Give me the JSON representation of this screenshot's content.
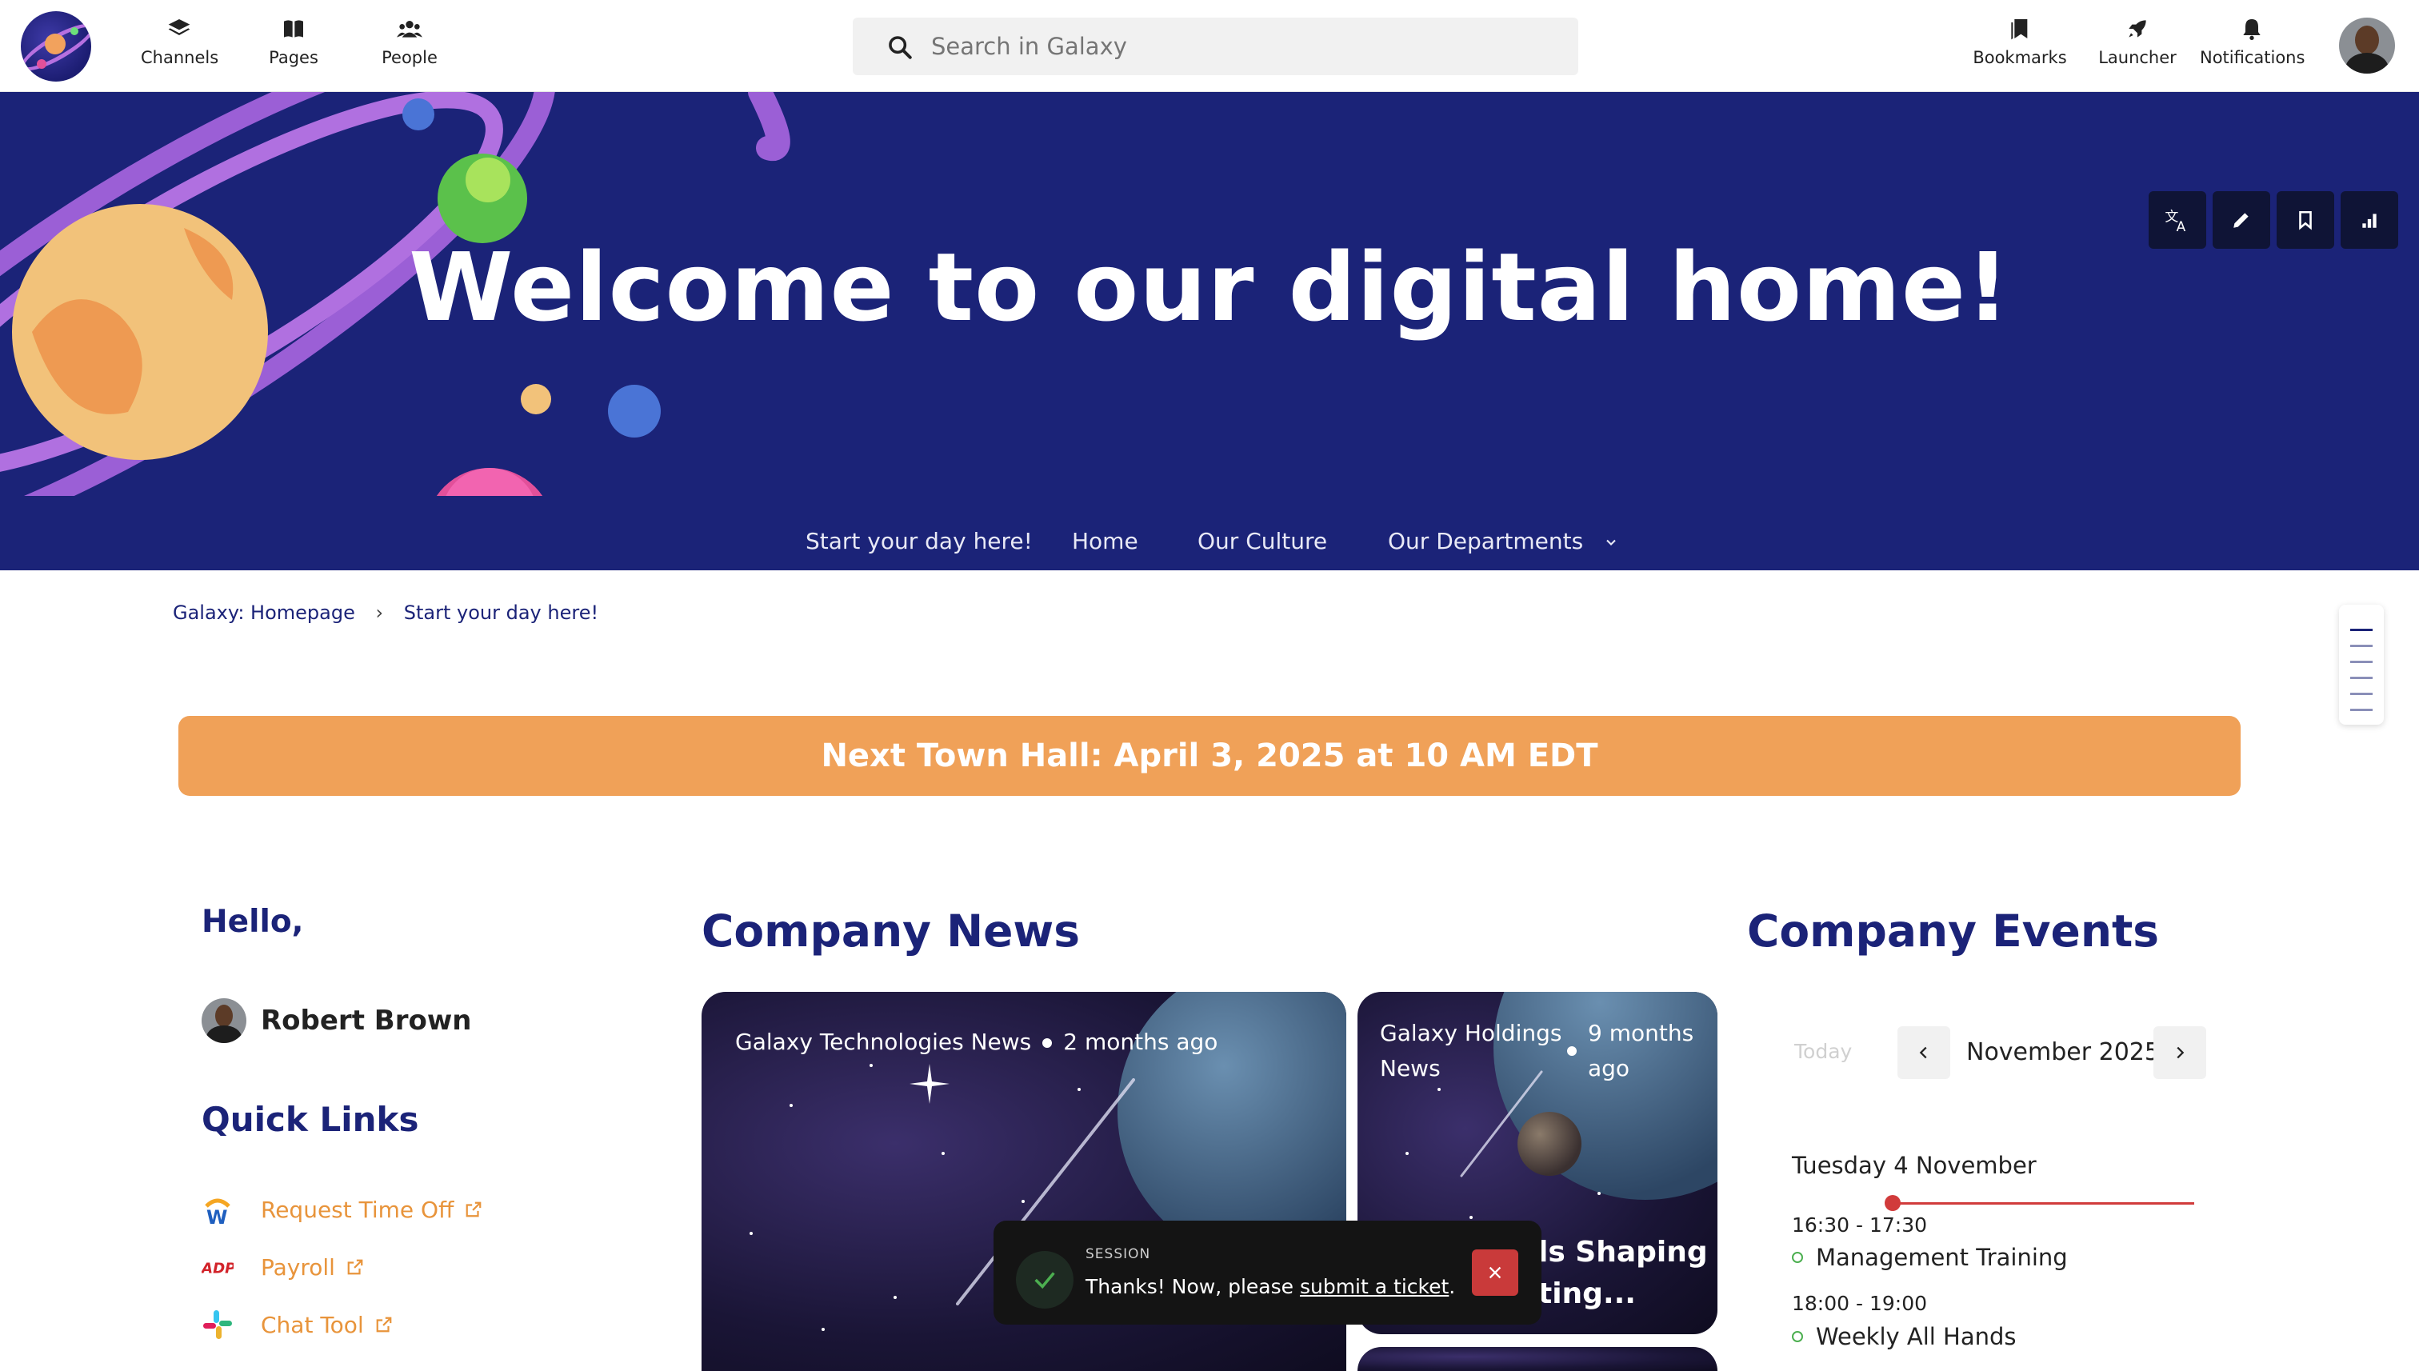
{
  "header": {
    "nav": [
      {
        "label": "Channels",
        "icon": "layers-icon"
      },
      {
        "label": "Pages",
        "icon": "book-icon"
      },
      {
        "label": "People",
        "icon": "people-icon"
      }
    ],
    "search_placeholder": "Search in Galaxy",
    "right_nav": [
      {
        "label": "Bookmarks",
        "icon": "bookmarks-icon"
      },
      {
        "label": "Launcher",
        "icon": "rocket-icon"
      },
      {
        "label": "Notifications",
        "icon": "bell-icon"
      }
    ]
  },
  "hero": {
    "title": "Welcome to our digital home!",
    "tools": [
      "translate-icon",
      "edit-icon",
      "bookmark-icon",
      "analytics-icon"
    ],
    "nav": [
      {
        "label": "Start your day here!"
      },
      {
        "label": "Home"
      },
      {
        "label": "Our Culture"
      },
      {
        "label": "Our Departments"
      }
    ]
  },
  "breadcrumb": {
    "root": "Galaxy: Homepage",
    "current": "Start your day here!"
  },
  "banner": {
    "text": "Next Town Hall: April 3, 2025 at 10 AM EDT",
    "color": "#f0a158"
  },
  "left": {
    "hello": "Hello,",
    "user_name": "Robert Brown",
    "quick_links_title": "Quick Links",
    "quick_links": [
      {
        "label": "Request Time Off",
        "icon": "workday-icon"
      },
      {
        "label": "Payroll",
        "icon": "adp-icon"
      },
      {
        "label": "Chat Tool",
        "icon": "slack-icon"
      }
    ]
  },
  "news": {
    "title": "Company News",
    "cards": [
      {
        "source": "Galaxy Technologies News",
        "time": "2 months ago"
      },
      {
        "source_line1": "Galaxy Holdings",
        "source_line2": "News",
        "time_line1": "9 months",
        "time_line2": "ago",
        "headline_line1": "ls Shaping",
        "headline_line2": "ting..."
      }
    ]
  },
  "toast": {
    "label": "SESSION",
    "message_prefix": "Thanks! Now, please ",
    "link": "submit a ticket",
    "message_suffix": "."
  },
  "events": {
    "title": "Company Events",
    "today_label": "Today",
    "month": "November 2025",
    "day": "Tuesday 4 November",
    "items": [
      {
        "time": "16:30 - 17:30",
        "name": "Management Training"
      },
      {
        "time": "18:00 - 19:00",
        "name": "Weekly All Hands"
      }
    ]
  },
  "colors": {
    "brand_navy": "#1b2378",
    "accent_orange": "#e8943b",
    "event_red": "#d13b3b"
  }
}
